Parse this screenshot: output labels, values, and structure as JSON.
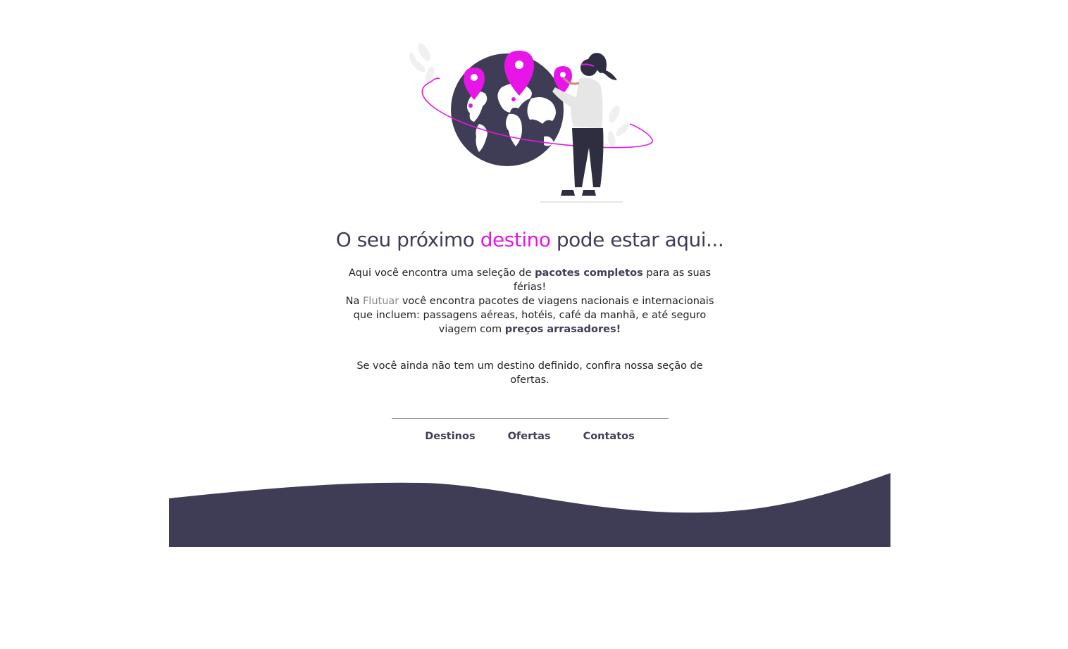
{
  "hero": {
    "title_prefix": "O seu próximo",
    "title_accent": "destino",
    "title_suffix": "pode estar aqui..."
  },
  "intro": {
    "p1_a": "Aqui você encontra uma seleção de",
    "p1_bold": "pacotes completos",
    "p1_b": "para as suas férias!",
    "p2_a": "Na",
    "p2_brand": "Flutuar",
    "p2_b": "você encontra pacotes de viagens nacionais e internacionais que incluem: passagens aéreas, hotéis, café da manhã, e até seguro viagem com",
    "p2_bold": "preços arrasadores!",
    "p3": "Se você ainda não tem um destino definido, confira nossa seção de ofertas."
  },
  "nav": {
    "destinos": "Destinos",
    "ofertas": "Ofertas",
    "contatos": "Contatos"
  },
  "colors": {
    "accent": "#e815e8",
    "dark": "#3f3d56",
    "brand_text": "#888888"
  },
  "icons": {
    "hero": "traveler-globe-illustration",
    "footer": "footer-wave"
  }
}
